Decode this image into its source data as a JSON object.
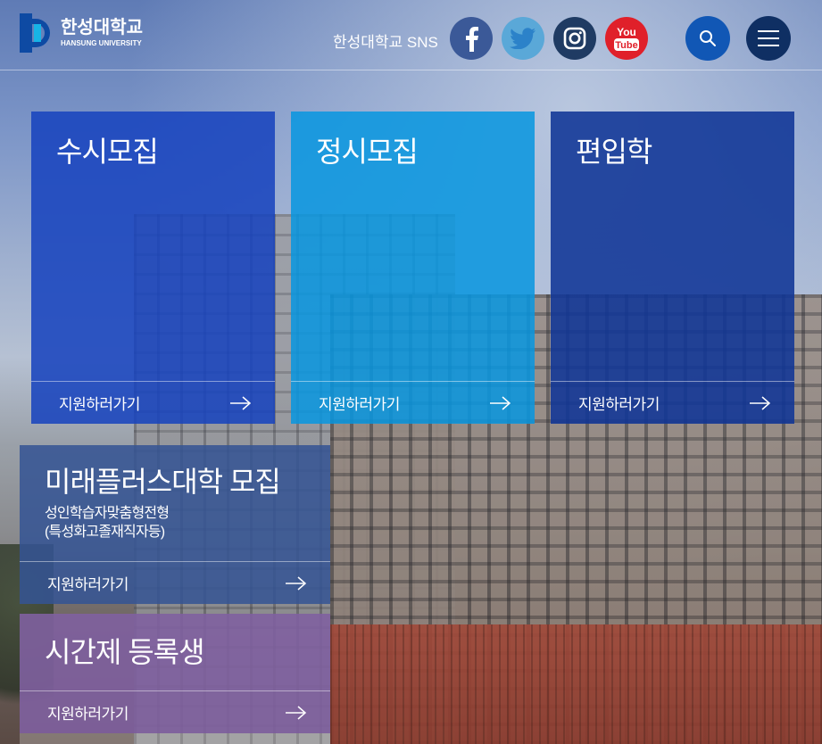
{
  "header": {
    "logo": {
      "korean": "한성대학교",
      "english": "HANSUNG UNIVERSITY"
    },
    "sns_label": "한성대학교 SNS",
    "sns": [
      {
        "name": "facebook",
        "icon": "facebook-icon",
        "color": "#3b5998"
      },
      {
        "name": "twitter",
        "icon": "twitter-icon",
        "color": "#5aa8d8"
      },
      {
        "name": "instagram",
        "icon": "instagram-icon",
        "color": "#1f3b63"
      },
      {
        "name": "youtube",
        "icon": "youtube-icon",
        "color": "#e0202a",
        "text_top": "You",
        "text_bottom": "Tube"
      }
    ],
    "search_icon": "search-icon",
    "menu_icon": "hamburger-menu-icon"
  },
  "tiles": {
    "susi": {
      "title": "수시모집",
      "cta": "지원하러가기"
    },
    "jeongsi": {
      "title": "정시모집",
      "cta": "지원하러가기"
    },
    "transfer": {
      "title": "편입학",
      "cta": "지원하러가기"
    },
    "mirae": {
      "title": "미래플러스대학 모집",
      "subtitle_line1": "성인학습자맞춤형전형",
      "subtitle_line2": "(특성화고졸재직자등)",
      "cta": "지원하러가기"
    },
    "parttime": {
      "title": "시간제 등록생",
      "cta": "지원하러가기"
    }
  },
  "colors": {
    "susi_tile": "#1642be",
    "jeongsi_tile": "#0896e0",
    "transfer_tile": "#103696",
    "mirae_tile": "#345494",
    "parttime_tile": "#8060a0"
  }
}
